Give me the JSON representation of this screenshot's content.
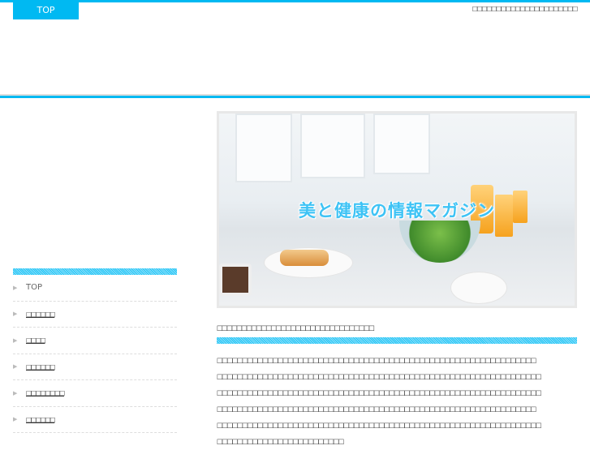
{
  "header": {
    "top_label": "TOP",
    "tagline": "□□□□□□□□□□□□□□□□□□□□□□"
  },
  "hero": {
    "title": "美と健康の情報マガジン"
  },
  "sidebar": {
    "items": [
      {
        "label": "TOP"
      },
      {
        "label": "□□□□□□"
      },
      {
        "label": "□□□□"
      },
      {
        "label": "□□□□□□"
      },
      {
        "label": "□□□□□□□□"
      },
      {
        "label": "□□□□□□"
      }
    ]
  },
  "article": {
    "title": "□□□□□□□□□□□□□□□□□□□□□□□□□□□□□□□□",
    "lines": [
      "□□□□□□□□□□□□□□□□□□□□□□□□□□□□□□□□□□□□□□□□□□□□□□□□□□□□□□□□□□□□□□□",
      "□□□□□□□□□□□□□□□□□□□□□□□□□□□□□□□□□□□□□□□□□□□□□□□□□□□□□□□□□□□□□□□□",
      "□□□□□□□□□□□□□□□□□□□□□□□□□□□□□□□□□□□□□□□□□□□□□□□□□□□□□□□□□□□□□□□□",
      "□□□□□□□□□□□□□□□□□□□□□□□□□□□□□□□□□□□□□□□□□□□□□□□□□□□□□□□□□□□□□□□",
      "□□□□□□□□□□□□□□□□□□□□□□□□□□□□□□□□□□□□□□□□□□□□□□□□□□□□□□□□□□□□□□□□",
      "□□□□□□□□□□□□□□□□□□□□□□□□□"
    ]
  },
  "colors": {
    "accent": "#00b9f2"
  }
}
